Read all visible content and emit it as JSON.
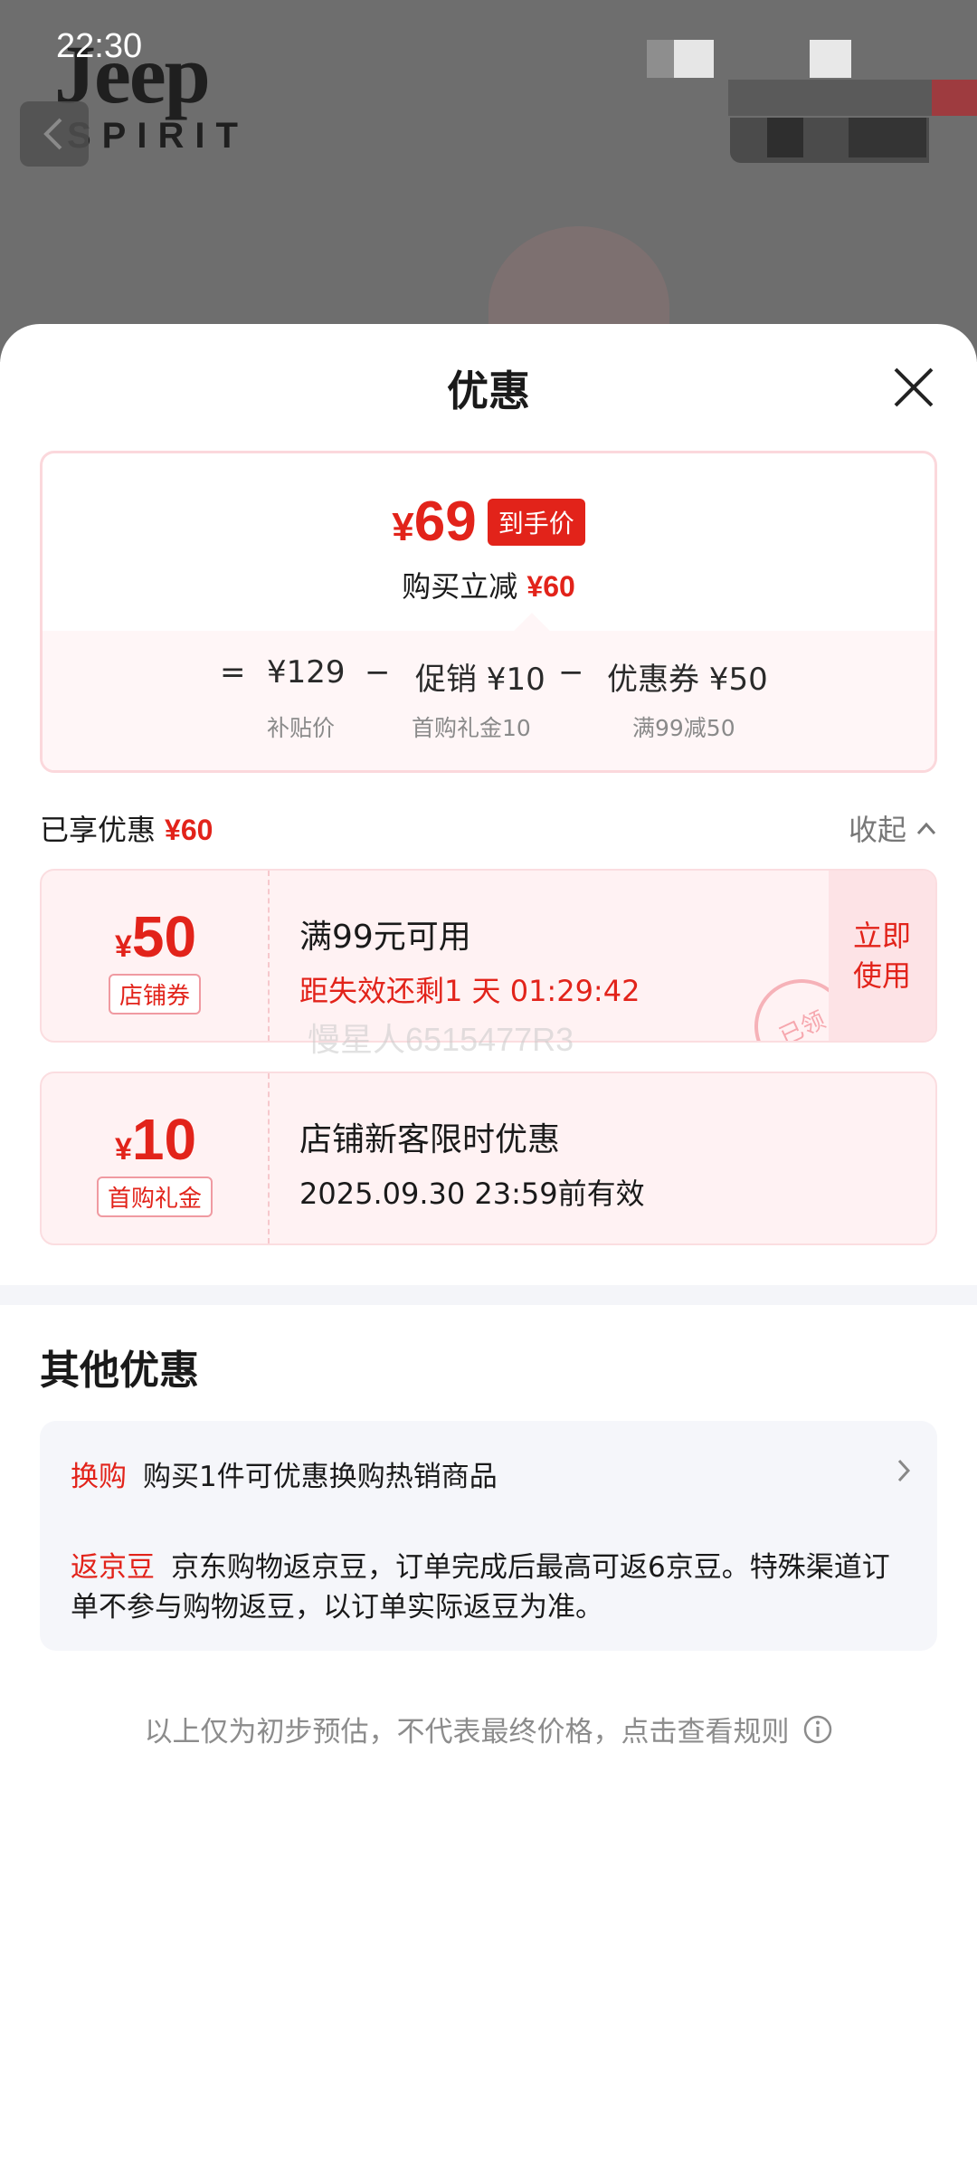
{
  "status_bar": {
    "time": "22:30"
  },
  "background": {
    "brand_logo_line1": "Jeep",
    "brand_logo_line2": "SPIRIT",
    "back_icon": "chevron-left-icon"
  },
  "sheet": {
    "title": "优惠",
    "close_icon": "close-icon"
  },
  "price_summary": {
    "currency": "¥",
    "final_price": "69",
    "final_tag": "到手价",
    "reduce_label": "购买立减",
    "reduce_amount": "¥60",
    "equals": "=",
    "minus": "−",
    "items": [
      {
        "label": "¥129",
        "sub": "补贴价"
      },
      {
        "label": "促销 ¥10",
        "sub": "首购礼金10"
      },
      {
        "label": "优惠券 ¥50",
        "sub": "满99减50"
      }
    ]
  },
  "enjoyed": {
    "label": "已享优惠",
    "amount": "¥60",
    "collapse_label": "收起",
    "collapse_icon": "chevron-up-icon"
  },
  "coupons": [
    {
      "currency": "¥",
      "value": "50",
      "type": "店铺券",
      "condition": "满99元可用",
      "expire": "距失效还剩1 天 01:29:42",
      "action": "立即使用",
      "stamp": "已领"
    },
    {
      "currency": "¥",
      "value": "10",
      "type": "首购礼金",
      "condition": "店铺新客限时优惠",
      "expire": "2025.09.30 23:59前有效"
    }
  ],
  "watermark": "慢星人6515477R3",
  "other_offers": {
    "title": "其他优惠",
    "items": [
      {
        "tag": "换购",
        "text": "购买1件可优惠换购热销商品",
        "icon": "chevron-right-icon"
      },
      {
        "tag": "返京豆",
        "text": "京东购物返京豆，订单完成后最高可返6京豆。特殊渠道订单不参与购物返豆，以订单实际返豆为准。"
      }
    ]
  },
  "footnote": {
    "text": "以上仅为初步预估，不代表最终价格，点击查看规则",
    "icon": "info-icon"
  },
  "colors": {
    "accent_red": "#e2231a",
    "coupon_bg": "#fff2f3",
    "muted_text": "#8c8c8c"
  }
}
